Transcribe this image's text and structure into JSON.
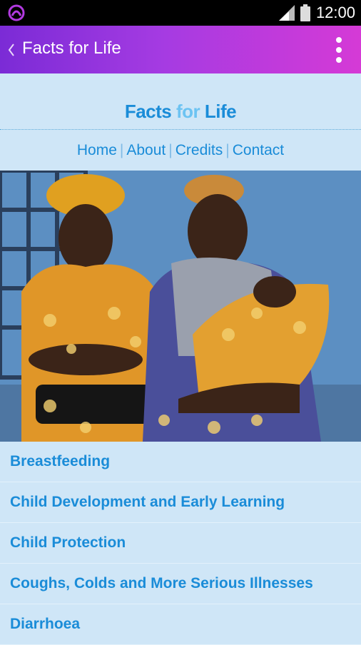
{
  "status_bar": {
    "time": "12:00",
    "icons": [
      "app-notification-icon",
      "signal-icon",
      "battery-icon"
    ]
  },
  "app_bar": {
    "title": "Facts for Life",
    "back_icon": "chevron-left-icon",
    "menu_icon": "overflow-menu-icon"
  },
  "header": {
    "logo": {
      "part1": "Facts",
      "part2": "for",
      "part3": "Life"
    },
    "nav": [
      "Home",
      "About",
      "Credits",
      "Contact"
    ]
  },
  "topics": [
    "Breastfeeding",
    "Child Development and Early Learning",
    "Child Protection",
    "Coughs, Colds and More Serious Illnesses",
    "Diarrhoea"
  ],
  "colors": {
    "app_bar_start": "#7b2bd6",
    "app_bar_end": "#d53ad6",
    "link_blue": "#1a8cd8",
    "background": "#cfe6f7"
  }
}
